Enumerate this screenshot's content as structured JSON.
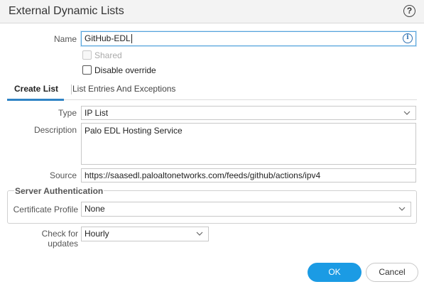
{
  "dialog": {
    "title": "External Dynamic Lists",
    "help_icon": "question-icon"
  },
  "name_field": {
    "label": "Name",
    "value": "GitHub-EDL",
    "info_icon": "info-icon"
  },
  "shared": {
    "label": "Shared",
    "checked": false,
    "disabled": true
  },
  "disable_override": {
    "label": "Disable override",
    "checked": false
  },
  "tabs": [
    {
      "label": "Create List",
      "active": true
    },
    {
      "label": "List Entries And Exceptions",
      "active": false
    }
  ],
  "type_field": {
    "label": "Type",
    "value": "IP List"
  },
  "description_field": {
    "label": "Description",
    "value": "Palo EDL Hosting Service"
  },
  "source_field": {
    "label": "Source",
    "value": "https://saasedl.paloaltonetworks.com/feeds/github/actions/ipv4"
  },
  "server_auth": {
    "legend": "Server Authentication",
    "certificate_profile": {
      "label": "Certificate Profile",
      "value": "None"
    }
  },
  "check_updates": {
    "label": "Check for updates",
    "value": "Hourly"
  },
  "buttons": {
    "ok": "OK",
    "cancel": "Cancel"
  },
  "colors": {
    "accent": "#1b9be4",
    "tab_underline": "#2f83c5",
    "focus_border": "#56a4dc"
  }
}
